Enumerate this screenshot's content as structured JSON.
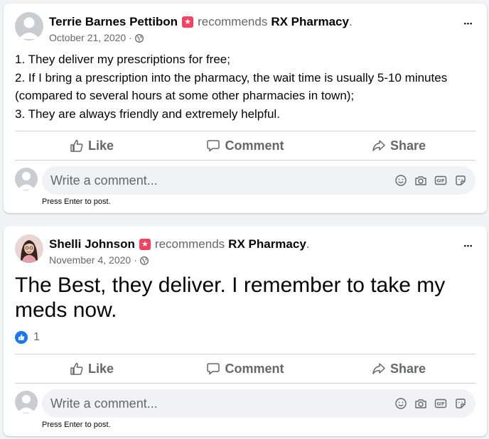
{
  "posts": [
    {
      "author": "Terrie Barnes Pettibon",
      "recommends_word": "recommends",
      "page_name": "RX Pharmacy",
      "period": ".",
      "date": "October 21, 2020",
      "meta_sep": "·",
      "body_lines": [
        "1.  They deliver my prescriptions for free;",
        "2.  If I bring a prescription into the pharmacy, the wait time is usually 5-10 minutes (compared to several hours at some other pharmacies in town);",
        "3.  They are always friendly and extremely helpful."
      ],
      "more_label": "•••"
    },
    {
      "author": "Shelli Johnson",
      "recommends_word": "recommends",
      "page_name": "RX Pharmacy",
      "period": ".",
      "date": "November 4, 2020",
      "meta_sep": "·",
      "body": "The Best, they deliver. I remember to take my meds now.",
      "reaction_count": "1",
      "more_label": "•••"
    }
  ],
  "actions": {
    "like": "Like",
    "comment": "Comment",
    "share": "Share"
  },
  "comment_box": {
    "placeholder": "Write a comment...",
    "hint": "Press Enter to post."
  },
  "colors": {
    "badge": "#f3425f",
    "like_blue": "#1877f2",
    "secondary_text": "#65676b"
  },
  "icons": [
    "globe-icon",
    "more-options-icon",
    "like-icon",
    "comment-icon",
    "share-icon",
    "emoji-icon",
    "camera-icon",
    "gif-icon",
    "sticker-icon",
    "recommend-badge-icon"
  ]
}
